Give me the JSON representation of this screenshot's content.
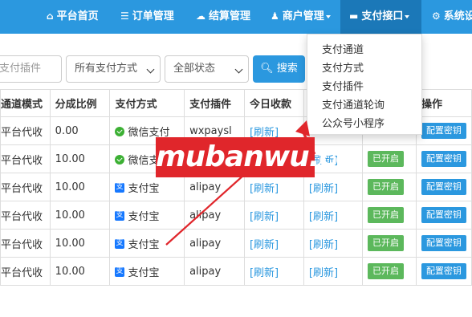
{
  "nav": {
    "items": [
      {
        "icon": "home-icon",
        "glyph": "⌂",
        "label": "平台首页"
      },
      {
        "icon": "list-icon",
        "glyph": "☰",
        "label": "订单管理"
      },
      {
        "icon": "cloud-icon",
        "glyph": "☁",
        "label": "结算管理"
      },
      {
        "icon": "user-icon",
        "glyph": "♟",
        "label": "商户管理"
      },
      {
        "icon": "card-icon",
        "glyph": "▬",
        "label": "支付接口"
      },
      {
        "icon": "gear-icon",
        "glyph": "⚙",
        "label": "系统设"
      }
    ]
  },
  "filters": {
    "plugin_placeholder": "支付插件",
    "method_select": "所有支付方式",
    "status_select": "全部状态",
    "search_label": "搜索"
  },
  "dropdown": {
    "items": [
      "支付通道",
      "支付方式",
      "支付插件",
      "支付通道轮询",
      "公众号小程序"
    ]
  },
  "table": {
    "headers": [
      "通道模式",
      "分成比例",
      "支付方式",
      "支付插件",
      "今日收款",
      "",
      "",
      "操作"
    ],
    "rows": [
      {
        "mode": "平台代收",
        "ratio": "0.00",
        "method": "微信支付",
        "method_icon": "wechat-pay-icon",
        "plugin": "wxpaysl",
        "today": "[刷新]",
        "yesterday": "",
        "status": "",
        "action": "配置密钥"
      },
      {
        "mode": "平台代收",
        "ratio": "10.00",
        "method": "微信支",
        "method_icon": "wechat-pay-icon",
        "plugin": "",
        "today": "",
        "yesterday": "[刷新]",
        "status": "已开启",
        "action": "配置密钥"
      },
      {
        "mode": "平台代收",
        "ratio": "10.00",
        "method": "支付宝",
        "method_icon": "alipay-icon",
        "plugin": "alipay",
        "today": "[刷新]",
        "yesterday": "[刷新]",
        "status": "已开启",
        "action": "配置密钥"
      },
      {
        "mode": "平台代收",
        "ratio": "10.00",
        "method": "支付宝",
        "method_icon": "alipay-icon",
        "plugin": "alipay",
        "today": "[刷新]",
        "yesterday": "[刷新]",
        "status": "已开启",
        "action": "配置密钥"
      },
      {
        "mode": "平台代收",
        "ratio": "10.00",
        "method": "支付宝",
        "method_icon": "alipay-icon",
        "plugin": "alipay",
        "today": "[刷新]",
        "yesterday": "[刷新]",
        "status": "已开启",
        "action": "配置密钥"
      },
      {
        "mode": "平台代收",
        "ratio": "10.00",
        "method": "支付宝",
        "method_icon": "alipay-icon",
        "plugin": "alipay",
        "today": "[刷新]",
        "yesterday": "[刷新]",
        "status": "已开启",
        "action": "配置密钥"
      }
    ]
  },
  "watermark": "mubanwu.cc",
  "colors": {
    "nav": "#2b98df",
    "nav_active": "#1b78b8",
    "success": "#5cb85c",
    "watermark": "#e0262b",
    "arrow": "#e0262b"
  }
}
